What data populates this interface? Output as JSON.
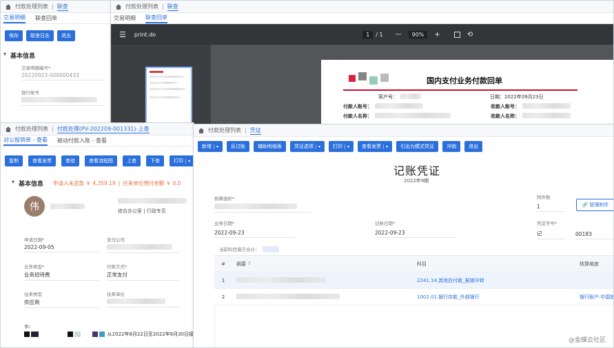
{
  "win1": {
    "breadcrumb": [
      "付款处理列表",
      "联查"
    ],
    "subtabs": [
      "交易明细",
      "联查回单"
    ],
    "buttons": [
      "保存",
      "联查日志",
      "退出"
    ],
    "section": "基本信息",
    "fields": [
      {
        "label": "交易明细编号*",
        "value": "20220923-000000433"
      },
      {
        "label": "银行账号",
        "value": ""
      }
    ]
  },
  "win2": {
    "breadcrumb": [
      "付款处理列表",
      "联查"
    ],
    "subtabs": [
      "交易明细",
      "联查回单"
    ],
    "pdf": {
      "filename": "print.do",
      "page_current": "1",
      "page_total": "/ 1",
      "zoom": "90%",
      "minus": "—",
      "plus": "+",
      "receipt_title": "国内支付业务付款回单",
      "customer_no_label": "客户号：",
      "date_label": "日期：2022年09月23日",
      "payer_account_label": "付款人账号：",
      "payer_name_label": "付款人名称：",
      "payee_account_label": "收款人账号：",
      "payee_name_label": "收款人名称："
    }
  },
  "win3": {
    "breadcrumb": [
      "付款处理列表",
      "付款处理(PV-202209-001331)-上查"
    ],
    "subtabs": [
      "对公报销单 - 查看",
      "被动付款入账 - 查看"
    ],
    "buttons": [
      "复制",
      "查看发票",
      "查验",
      "查看流程图",
      "上查",
      "下查",
      "打印"
    ],
    "section": "基本信息",
    "alert1": "申请人未还款 ￥ 4,359.19",
    "alert_sep": "|",
    "alert2": "往来单位预付余额 ￥ 0.0",
    "avatar_char": "伟",
    "dept": "综合办公室 | 行政专员",
    "fields": [
      {
        "label": "申请日期*",
        "value": "2022-09-05"
      },
      {
        "label": "支付公司",
        "value": ""
      },
      {
        "label": "业务类型*",
        "value": "业务招待费"
      },
      {
        "label": "付款方式*",
        "value": "正常支付"
      },
      {
        "label": "往来类型",
        "value": "供应商"
      },
      {
        "label": "往来单位",
        "value": ""
      }
    ],
    "reason_label": "事r",
    "reason_text": "从2022年8月22日至2022年8月30日接"
  },
  "win4": {
    "breadcrumb": [
      "付款处理列表",
      "凭证"
    ],
    "buttons": [
      "新增",
      "反过账",
      "辅助明细表",
      "凭证选项",
      "打印",
      "查看发票",
      "引出为模式凭证",
      "冲销",
      "退出"
    ],
    "dropdown_buttons": [
      true,
      false,
      false,
      true,
      true,
      true,
      false,
      false,
      false
    ],
    "title": "记账凭证",
    "period": "2022年9期",
    "org_label": "核算组织*",
    "attach_label": "附件数",
    "attach_value": "1",
    "manage_attach": "管理附件",
    "bizdate_label": "业务日期*",
    "bizdate_value": "2022-09-23",
    "bookdate_label": "记账日期*",
    "bookdate_value": "2022-09-23",
    "vno_label": "凭证字号*",
    "vno_word": "记",
    "vno_number": "00183",
    "subject_total_label": "当前科目借方合计：",
    "table": {
      "headers": [
        "#",
        "摘要",
        "科目",
        "核算维度"
      ],
      "rows": [
        {
          "no": "1",
          "summary": "",
          "subject": "2241.14.其他应付款_报销中转",
          "dim": ""
        },
        {
          "no": "2",
          "summary": "",
          "subject": "1002.01.银行存款_外部银行",
          "dim": "银行账户:中国银"
        }
      ]
    }
  },
  "watermark": "@金蝶云社区",
  "colors": {
    "accent": "#2a6fdb",
    "alert": "#e8703a",
    "pdfbar": "#323639"
  }
}
